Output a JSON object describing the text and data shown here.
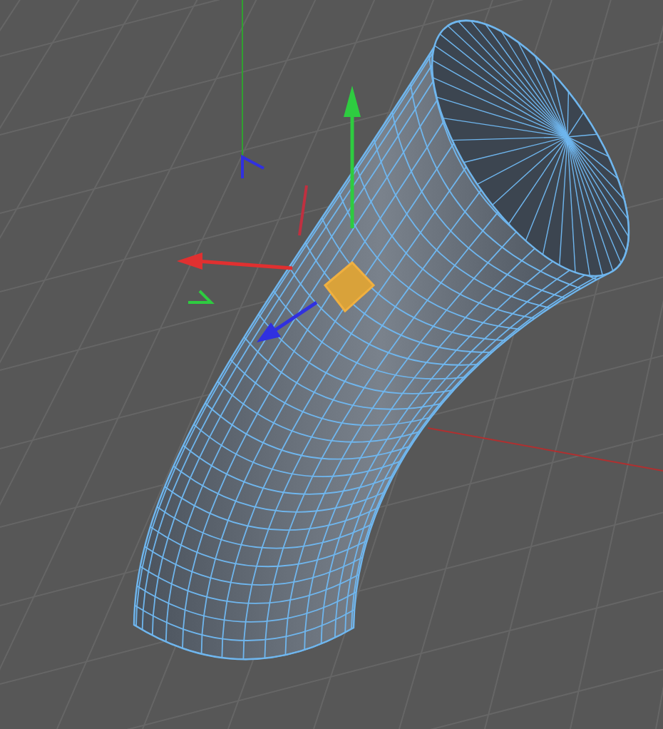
{
  "viewport": {
    "polygon": {
      "selected": true
    }
  }
}
